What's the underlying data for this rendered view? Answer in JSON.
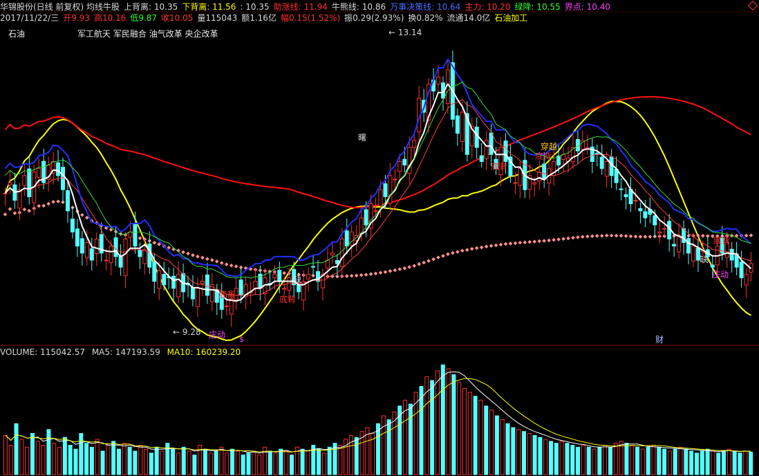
{
  "header": {
    "line1": [
      {
        "text": "华锦股份(日线 前复权) 均线牛股",
        "color": "w"
      },
      {
        "text": "上背离: 10.35",
        "color": "w"
      },
      {
        "text": "下背离: 11.56",
        "color": "y"
      },
      {
        "text": ": 10.35",
        "color": "w"
      },
      {
        "text": "助涨线: 11.94",
        "color": "r"
      },
      {
        "text": "牛熊线: 10.86",
        "color": "w"
      },
      {
        "text": "万事决策线: 10.64",
        "color": "b"
      },
      {
        "text": "主力: 10.20",
        "color": "r"
      },
      {
        "text": "绿降: 10.55",
        "color": "g"
      },
      {
        "text": "界点: 10.40",
        "color": "m"
      }
    ],
    "line2": [
      {
        "text": "2017/11/22/三",
        "color": "w"
      },
      {
        "text": "开9.93",
        "color": "r"
      },
      {
        "text": "高10.16",
        "color": "r"
      },
      {
        "text": "低9.87",
        "color": "g"
      },
      {
        "text": "收10.05",
        "color": "r"
      },
      {
        "text": "量115043",
        "color": "w"
      },
      {
        "text": "额1.16亿",
        "color": "w"
      },
      {
        "text": "幅0.15(1.52%)",
        "color": "r"
      },
      {
        "text": "振0.29(2.93%)",
        "color": "w"
      },
      {
        "text": "换0.82%",
        "color": "w"
      },
      {
        "text": "流通14.0亿",
        "color": "w"
      },
      {
        "text": "石油加工",
        "color": "y"
      }
    ]
  },
  "tags": {
    "sector": "石油",
    "concepts": "军工航天 军民融合 油气改革 央企改革"
  },
  "annotations": {
    "high_price": "13.14",
    "low_price": "9.28",
    "shu": "曙",
    "dibei": "底背",
    "que": "缺",
    "chuanyue": "穿越",
    "zhuangdong": "庄动",
    "cai": "财",
    "dollar": "$"
  },
  "volume_header": {
    "volume": "VOLUME: 115042.57",
    "ma5": "MA5: 147193.59",
    "ma10": "MA10: 160239.20"
  },
  "colors": {
    "up": "#ff3030",
    "down": "#54ffff",
    "ma_white": "#ffffff",
    "ma_red_long": "#ff1010",
    "band_yellow": "#ffff00",
    "channel_blue": "#2030ff",
    "channel_green": "#30e030",
    "pink_dots": "#ff9090",
    "magenta": "#ff40ff"
  },
  "chart_data": [
    {
      "type": "candlestick",
      "title": "华锦股份(日线 前复权)",
      "date_shown": "2017/11/22",
      "ylim": [
        9.0,
        13.4
      ],
      "last": {
        "open": 9.93,
        "high": 10.16,
        "low": 9.87,
        "close": 10.05,
        "volume": 115043
      },
      "extremes": {
        "high": 13.14,
        "low": 9.28
      },
      "close": [
        11.05,
        11.2,
        10.95,
        11.1,
        11.3,
        11.0,
        11.35,
        11.4,
        11.2,
        11.45,
        11.5,
        11.3,
        11.1,
        10.8,
        10.5,
        10.3,
        10.2,
        10.35,
        10.1,
        10.4,
        10.2,
        10.1,
        10.3,
        10.15,
        10.0,
        10.4,
        10.5,
        10.3,
        10.15,
        10.25,
        10.0,
        9.8,
        9.95,
        9.75,
        9.85,
        9.7,
        9.9,
        9.65,
        9.75,
        9.55,
        9.7,
        9.8,
        9.6,
        9.75,
        9.5,
        9.4,
        9.45,
        9.55,
        9.7,
        9.6,
        9.75,
        9.65,
        9.8,
        9.7,
        9.85,
        9.75,
        9.9,
        9.8,
        9.7,
        9.85,
        9.75,
        9.65,
        9.8,
        9.9,
        10.0,
        9.8,
        9.9,
        10.1,
        10.2,
        10.05,
        10.4,
        10.3,
        10.5,
        10.45,
        10.7,
        10.6,
        10.9,
        10.8,
        11.1,
        11.0,
        11.3,
        11.25,
        11.5,
        11.45,
        11.7,
        11.8,
        12.4,
        12.2,
        12.6,
        12.5,
        12.7,
        12.4,
        12.8,
        12.1,
        11.9,
        12.2,
        11.6,
        12.0,
        11.7,
        11.5,
        11.8,
        11.6,
        11.4,
        11.7,
        11.5,
        11.3,
        11.2,
        11.4,
        11.1,
        11.3,
        11.2,
        11.35,
        11.25,
        11.4,
        11.5,
        11.45,
        11.6,
        11.55,
        11.7,
        11.65,
        11.8,
        11.7,
        11.5,
        11.6,
        11.4,
        11.5,
        11.3,
        11.2,
        11.1,
        11.0,
        10.9,
        10.95,
        10.8,
        10.7,
        10.75,
        10.6,
        10.5,
        10.55,
        10.4,
        10.3,
        10.45,
        10.35,
        10.2,
        10.3,
        10.1,
        10.25,
        10.15,
        10.0,
        10.3,
        10.2,
        10.35,
        10.1,
        10.0,
        9.85,
        9.9,
        10.05
      ]
    },
    {
      "type": "bar",
      "title": "VOLUME",
      "last": {
        "volume": 115042.57,
        "ma5": 147193.59,
        "ma10": 160239.2
      },
      "ylim": [
        0,
        600000
      ],
      "values": [
        200000,
        150000,
        260000,
        180000,
        140000,
        210000,
        170000,
        150000,
        230000,
        160000,
        140000,
        190000,
        150000,
        130000,
        210000,
        160000,
        140000,
        180000,
        120000,
        150000,
        170000,
        130000,
        160000,
        140000,
        120000,
        150000,
        130000,
        110000,
        140000,
        120000,
        160000,
        130000,
        110000,
        140000,
        120000,
        100000,
        150000,
        130000,
        110000,
        120000,
        140000,
        110000,
        130000,
        120000,
        100000,
        110000,
        120000,
        100000,
        140000,
        120000,
        110000,
        130000,
        120000,
        100000,
        140000,
        130000,
        120000,
        150000,
        130000,
        110000,
        140000,
        160000,
        150000,
        180000,
        200000,
        190000,
        220000,
        240000,
        210000,
        260000,
        300000,
        280000,
        320000,
        350000,
        380000,
        360000,
        420000,
        450000,
        500000,
        480000,
        530000,
        560000,
        540000,
        510000,
        470000,
        440000,
        420000,
        400000,
        380000,
        350000,
        330000,
        300000,
        280000,
        260000,
        240000,
        230000,
        220000,
        210000,
        200000,
        190000,
        180000,
        170000,
        160000,
        170000,
        160000,
        150000,
        140000,
        150000,
        140000,
        130000,
        140000,
        150000,
        140000,
        160000,
        170000,
        160000,
        150000,
        140000,
        130000,
        140000,
        150000,
        140000,
        130000,
        120000,
        130000,
        140000,
        130000,
        120000,
        110000,
        120000,
        130000,
        120000,
        110000,
        120000,
        130000,
        120000,
        110000,
        120000,
        115043
      ]
    }
  ]
}
